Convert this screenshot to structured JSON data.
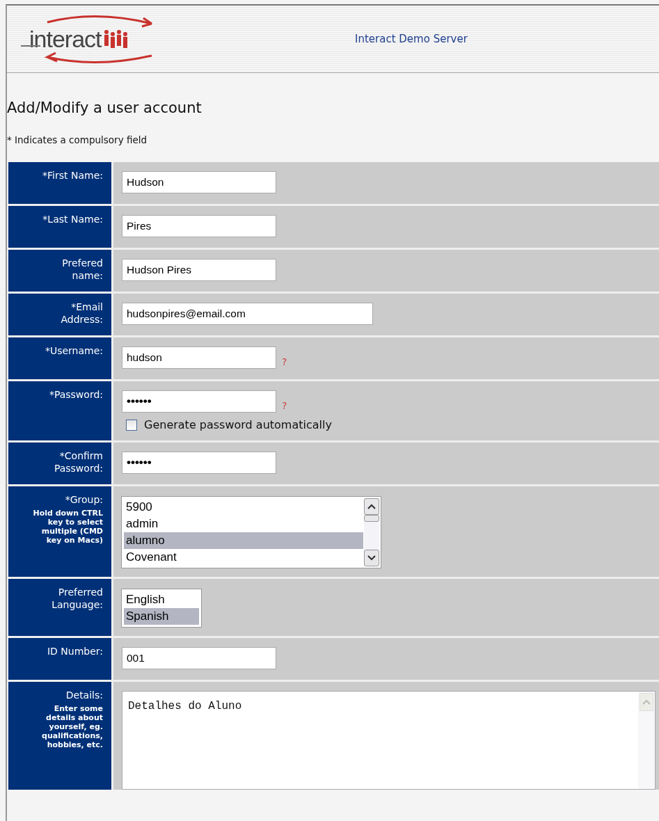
{
  "header": {
    "logo": "interact",
    "server_name": "Interact Demo Server"
  },
  "page": {
    "title": "Add/Modify a user account",
    "note": "* Indicates a compulsory field"
  },
  "form": {
    "rows": [
      {
        "kind": "text",
        "label": "*First Name:",
        "value": "Hudson"
      },
      {
        "kind": "text",
        "label": "*Last Name:",
        "value": "Pires"
      },
      {
        "kind": "text",
        "label": "Prefered name:",
        "value": "Hudson Pires"
      },
      {
        "kind": "email",
        "label": "*Email Address:",
        "value": "hudsonpires@email.com"
      },
      {
        "kind": "text",
        "label": "*Username:",
        "value": "hudson",
        "help": "?"
      },
      {
        "kind": "password",
        "label": "*Password:",
        "value": "••••••",
        "help": "?",
        "checkbox": {
          "label": "Generate password automatically",
          "checked": false
        }
      },
      {
        "kind": "password",
        "label": "*Confirm Password:",
        "value": "••••••"
      },
      {
        "kind": "listbox",
        "label": "*Group:",
        "note": "Hold down CTRL key to select multiple (CMD key on Macs)",
        "scrollbar": true,
        "options": [
          {
            "label": "5900",
            "selected": false
          },
          {
            "label": "admin",
            "selected": false
          },
          {
            "label": "alumno",
            "selected": true
          },
          {
            "label": "Covenant",
            "selected": false
          }
        ]
      },
      {
        "kind": "listbox",
        "label": "Preferred Language:",
        "scrollbar": false,
        "options": [
          {
            "label": "English",
            "selected": false
          },
          {
            "label": "Spanish",
            "selected": true
          }
        ]
      },
      {
        "kind": "text",
        "label": "ID Number:",
        "value": "001"
      },
      {
        "kind": "textarea",
        "label": "Details:",
        "note": "Enter some details about yourself, eg. qualifications, hobbies, etc.",
        "value": "Detalhes do Aluno"
      }
    ]
  }
}
